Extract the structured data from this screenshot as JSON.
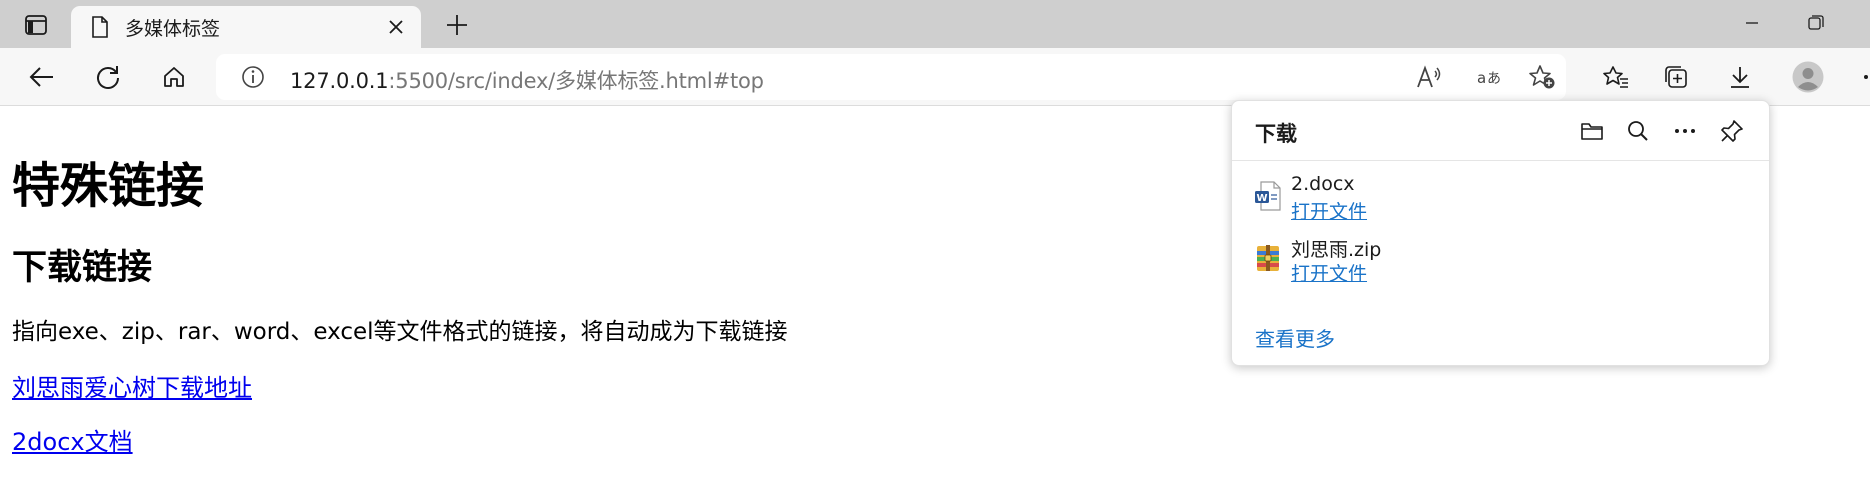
{
  "tab": {
    "title": "多媒体标签"
  },
  "address_bar": {
    "url_host": "127.0.0.1",
    "url_rest": ":5500/src/index/多媒体标签.html#top"
  },
  "page": {
    "heading": "特殊链接",
    "subheading": "下载链接",
    "description": "指向exe、zip、rar、word、excel等文件格式的链接，将自动成为下载链接",
    "links": [
      "刘思雨爱心树下载地址",
      "2docx文档"
    ]
  },
  "downloads": {
    "title": "下载",
    "items": [
      {
        "name": "2.docx",
        "action": "打开文件",
        "icon": "word-file-icon"
      },
      {
        "name": "刘思雨.zip",
        "action": "打开文件",
        "icon": "zip-archive-icon"
      }
    ],
    "more_label": "查看更多"
  },
  "colors": {
    "link": "#0000ee",
    "accent": "#1a73c8",
    "tabstrip": "#cfcfcf"
  }
}
